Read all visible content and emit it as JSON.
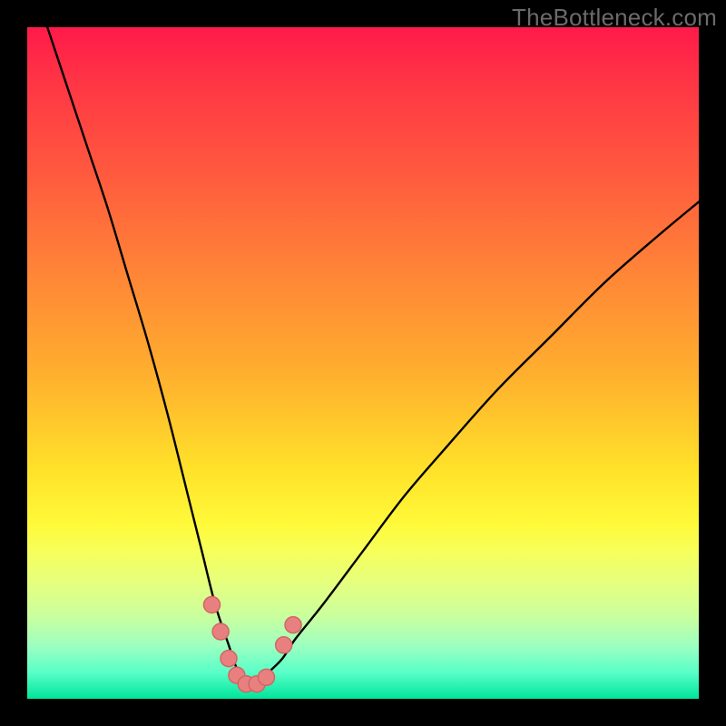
{
  "watermark": "TheBottleneck.com",
  "colors": {
    "frame": "#000000",
    "curve": "#000000",
    "dotFill": "#e98080",
    "dotStroke": "#d26565",
    "gradient_top": "#ff1a4a",
    "gradient_bottom": "#00e59a"
  },
  "chart_data": {
    "type": "line",
    "title": "",
    "xlabel": "",
    "ylabel": "",
    "xlim": [
      0,
      100
    ],
    "ylim": [
      0,
      100
    ],
    "grid": false,
    "note": "x is normalized horizontal position (0=left,100=right of plot); y is normalized vertical position (0=bottom,100=top). Curve approximates absolute deviation from an optimum near x≈33.",
    "series": [
      {
        "name": "bottleneck-curve",
        "x": [
          3,
          6,
          9,
          12,
          15,
          18,
          21,
          24,
          26,
          28,
          30,
          31,
          32,
          33,
          34,
          35,
          36,
          38,
          40,
          44,
          50,
          56,
          62,
          70,
          78,
          86,
          94,
          100
        ],
        "y": [
          100,
          91,
          82,
          73,
          63,
          53,
          42,
          30,
          22,
          14,
          8,
          5,
          3,
          2,
          2,
          3,
          4,
          6,
          9,
          14,
          22,
          30,
          37,
          46,
          54,
          62,
          69,
          74
        ]
      }
    ],
    "markers": {
      "name": "highlight-dots",
      "note": "Salmon dots near the minimum of the curve",
      "points": [
        {
          "x": 27.5,
          "y": 14
        },
        {
          "x": 28.8,
          "y": 10
        },
        {
          "x": 30.0,
          "y": 6
        },
        {
          "x": 31.2,
          "y": 3.5
        },
        {
          "x": 32.6,
          "y": 2.2
        },
        {
          "x": 34.2,
          "y": 2.2
        },
        {
          "x": 35.6,
          "y": 3.2
        },
        {
          "x": 38.2,
          "y": 8
        },
        {
          "x": 39.6,
          "y": 11
        }
      ],
      "radius_px": 9
    }
  }
}
